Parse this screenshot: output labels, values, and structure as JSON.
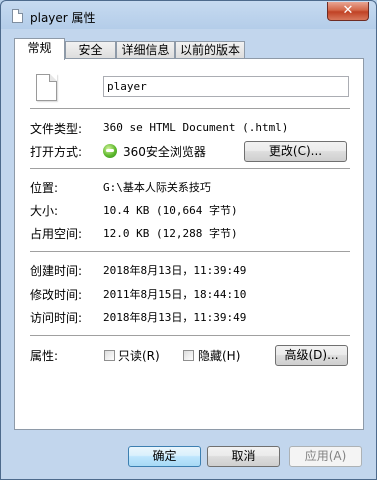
{
  "window": {
    "title": "player 属性",
    "close_glyph": "✕"
  },
  "tabs": [
    {
      "label": "常规"
    },
    {
      "label": "安全"
    },
    {
      "label": "详细信息"
    },
    {
      "label": "以前的版本"
    }
  ],
  "general": {
    "filename": "player",
    "file_type_label": "文件类型:",
    "file_type_value": "360 se HTML Document (.html)",
    "open_with_label": "打开方式:",
    "open_with_value": "360安全浏览器",
    "change_button": "更改(C)...",
    "location_label": "位置:",
    "location_value": "G:\\基本人际关系技巧",
    "size_label": "大小:",
    "size_value": "10.4 KB (10,664 字节)",
    "size_on_disk_label": "占用空间:",
    "size_on_disk_value": "12.0 KB (12,288 字节)",
    "created_label": "创建时间:",
    "created_value": "2018年8月13日，11:39:49",
    "modified_label": "修改时间:",
    "modified_value": "2011年8月15日，18:44:10",
    "accessed_label": "访问时间:",
    "accessed_value": "2018年8月13日，11:39:49",
    "attributes_label": "属性:",
    "readonly_label": "只读(R)",
    "hidden_label": "隐藏(H)",
    "advanced_button": "高级(D)..."
  },
  "footer": {
    "ok": "确定",
    "cancel": "取消",
    "apply": "应用(A)"
  }
}
